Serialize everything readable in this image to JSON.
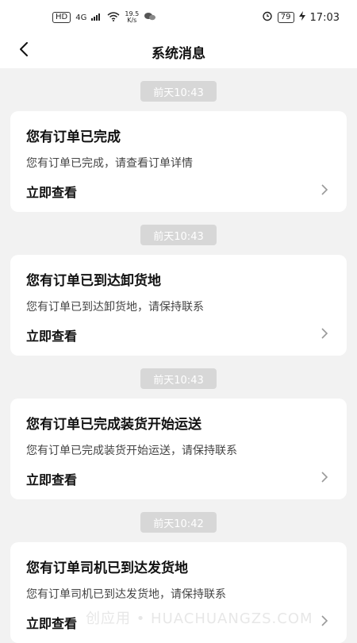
{
  "status_bar": {
    "left": {
      "hd": "HD",
      "network": "4G",
      "speed_value": "19.5",
      "speed_unit": "K/s"
    },
    "right": {
      "battery": "79",
      "time": "17:03"
    }
  },
  "nav": {
    "title": "系统消息"
  },
  "messages": [
    {
      "time": "前天10:43",
      "title": "您有订单已完成",
      "desc": "您有订单已完成，请查看订单详情",
      "action": "立即查看"
    },
    {
      "time": "前天10:43",
      "title": "您有订单已到达卸货地",
      "desc": "您有订单已到达卸货地，请保持联系",
      "action": "立即查看"
    },
    {
      "time": "前天10:43",
      "title": "您有订单已完成装货开始运送",
      "desc": "您有订单已完成装货开始运送，请保持联系",
      "action": "立即查看"
    },
    {
      "time": "前天10:42",
      "title": "您有订单司机已到达发货地",
      "desc": "您有订单司机已到达发货地，请保持联系",
      "action": "立即查看"
    }
  ],
  "watermark": "创应用 • HUACHUANGZS.COM"
}
